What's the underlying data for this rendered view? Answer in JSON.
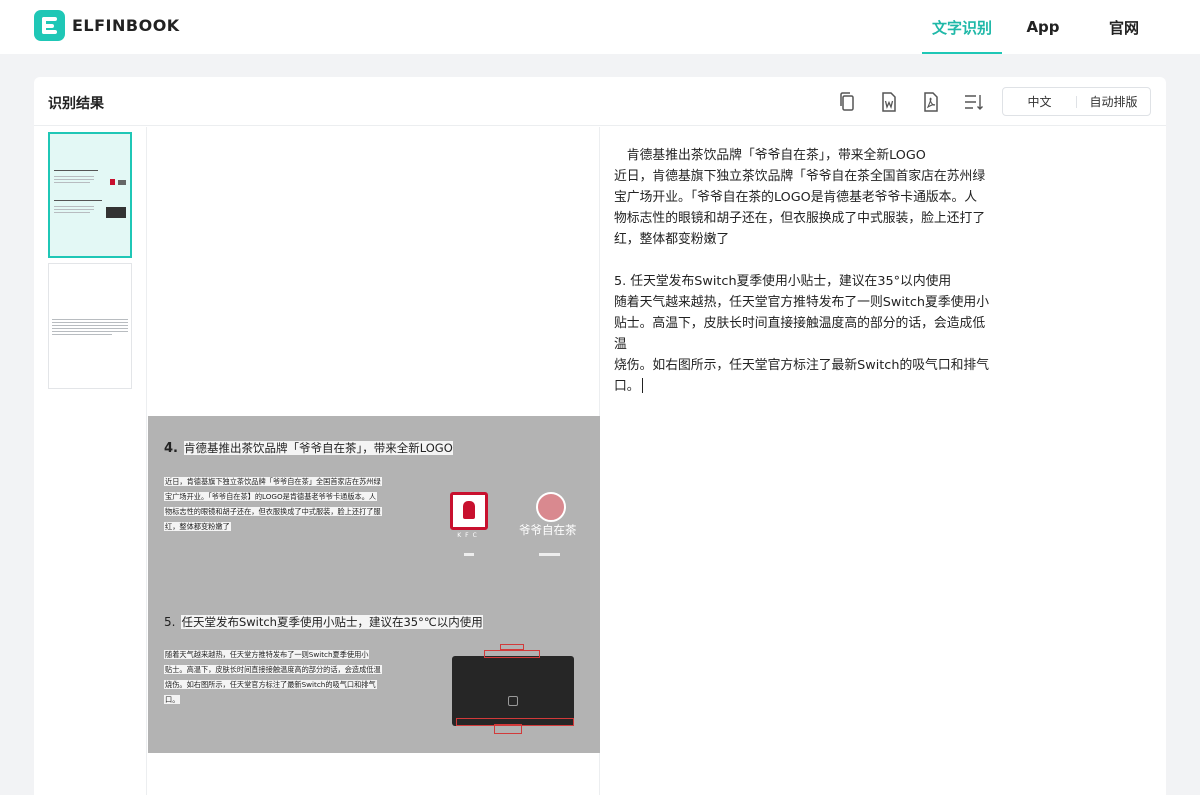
{
  "header": {
    "logo_text": "ELFINBOOK",
    "nav": [
      {
        "label": "文字识别",
        "active": true
      },
      {
        "label": "App",
        "active": false
      },
      {
        "label": "官网",
        "active": false
      }
    ]
  },
  "card": {
    "title": "识别结果",
    "toolbar_icons": [
      "copy-icon",
      "word-icon",
      "pdf-icon",
      "sort-lines-icon"
    ],
    "options": {
      "language": "中文",
      "layout": "自动排版"
    }
  },
  "thumbnails": {
    "count": 2,
    "active_index": 0
  },
  "preview": {
    "heading1": {
      "num": "4.",
      "text": "肯德基推出茶饮品牌「爷爷自在茶」，带来全新LOGO"
    },
    "para1": [
      "近日，肯德基旗下独立茶饮品牌「爷爷自在茶」全国首家店在苏州绿",
      "宝广场开业。「爷爷自在茶】的LOGO是肯德基老爷爷卡通版本。人",
      "物标志性的眼镜和胡子还在，但衣服换成了中式服装，脸上还打了服",
      "红，整体都变粉嫩了"
    ],
    "kfc_letters": "KFC",
    "brand_name": "爷爷自在茶",
    "heading2": {
      "num": "5.",
      "text": "任天堂发布Switch夏季使用小贴士，建议在35°℃以内使用"
    },
    "para2": [
      "随着天气越来越热，任天堂方推特发布了一则Switch夏季使用小",
      "贴士。高温下，皮肤长时间直接接触温度高的部分的话，会造成低温",
      "烧伤。如右图所示，任天堂官方标注了最新Switch的吸气口和排气",
      "口。"
    ],
    "colors": {
      "page_bg": "#b3b3b3",
      "highlight": "#f4f4f4"
    }
  },
  "result": {
    "lines": [
      "　肯德基推出茶饮品牌「爷爷自在茶」，带来全新LOGO",
      "近日，肯德基旗下独立茶饮品牌「爷爷自在茶全国首家店在苏州绿",
      "宝广场开业。「爷爷自在茶的LOGO是肯德基老爷爷卡通版本。人",
      "物标志性的眼镜和胡子还在，但衣服换成了中式服装，脸上还打了",
      "红，整体都变粉嫩了",
      "",
      "5. 任天堂发布Switch夏季使用小贴士，建议在35°以内使用",
      "随着天气越来越热，任天堂官方推特发布了一则Switch夏季使用小",
      "贴士。高温下，皮肤长时间直接接触温度高的部分的话，会造成低温",
      "烧伤。如右图所示，任天堂官方标注了最新Switch的吸气口和排气",
      "口。"
    ]
  },
  "accent_color": "#1fc7b6"
}
